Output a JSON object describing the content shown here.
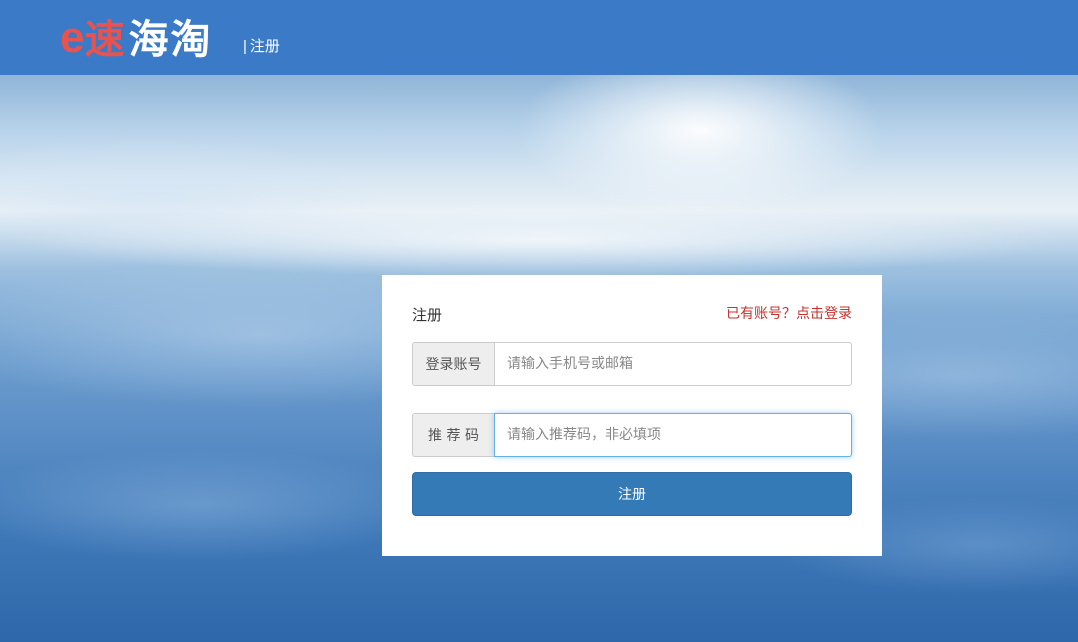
{
  "header": {
    "logo_e": "e",
    "logo_su": "速",
    "logo_haitao": "海淘",
    "separator": "|",
    "subtitle": "注册"
  },
  "form": {
    "title": "注册",
    "login_link": "已有账号？点击登录",
    "account": {
      "label": "登录账号",
      "placeholder": "请输入手机号或邮箱",
      "value": ""
    },
    "referral": {
      "label": "推 荐 码",
      "placeholder": "请输入推荐码，非必填项",
      "value": ""
    },
    "submit_label": "注册"
  },
  "colors": {
    "header_bg": "#3a7ac6",
    "logo_accent": "#e8534f",
    "button_primary": "#337ab7",
    "link_red": "#c9302c"
  }
}
